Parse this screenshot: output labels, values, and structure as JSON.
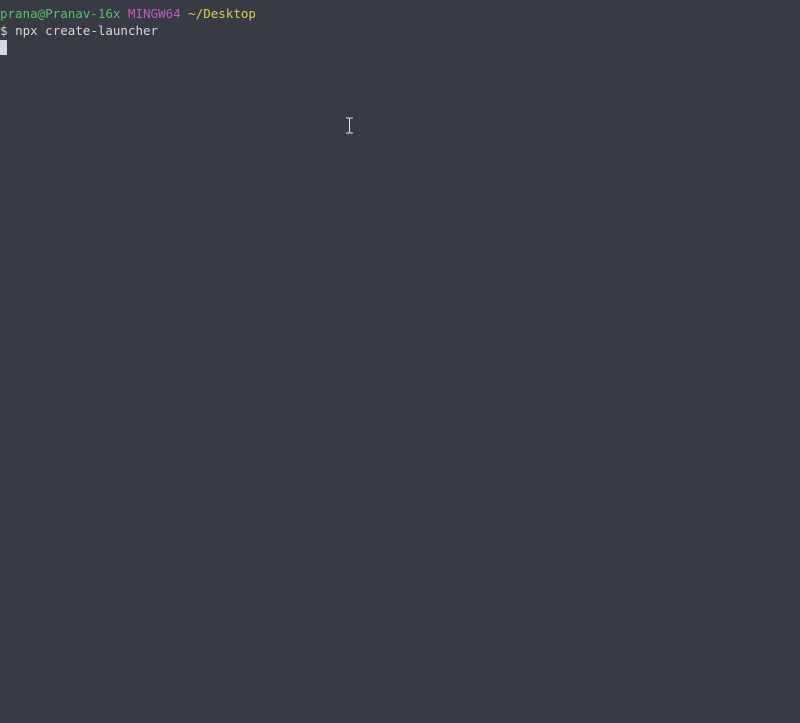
{
  "terminal": {
    "prompt_header": {
      "user_host": "prana@Pranav-16x",
      "system": "MINGW64",
      "cwd": "~/Desktop"
    },
    "prompt_symbol": "$",
    "command": "npx create-launcher"
  },
  "colors": {
    "background": "#383b43",
    "foreground": "#d6d8de",
    "user_host": "#4ec46b",
    "system": "#c45bbf",
    "cwd": "#d8cf4a"
  },
  "icons": {
    "mouse_pointer": "i-beam-cursor-icon",
    "text_cursor": "block-cursor-icon"
  }
}
